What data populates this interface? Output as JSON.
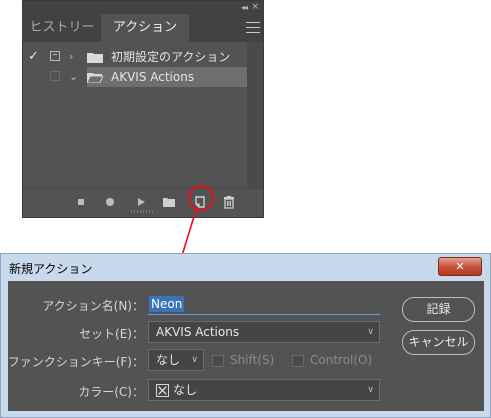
{
  "panel": {
    "tabs": [
      {
        "label": "ヒストリー",
        "active": false
      },
      {
        "label": "アクション",
        "active": true
      }
    ],
    "collapse_glyph": "◂◂",
    "close_glyph": "×",
    "rows": [
      {
        "check": "✓",
        "expanded": false,
        "label": "初期設定のアクション",
        "selected": false
      },
      {
        "check": "",
        "expanded": true,
        "label": "AKVIS Actions",
        "selected": true
      }
    ],
    "bottom_icons": [
      "stop-icon",
      "record-icon",
      "play-icon",
      "folder-icon",
      "new-action-icon",
      "trash-icon"
    ]
  },
  "annotation": {
    "color": "#e3101a"
  },
  "dialog": {
    "title": "新規アクション",
    "close_glyph": "✕",
    "name_label": "アクション名(N)：",
    "name_value": "Neon",
    "set_label": "セット(E)：",
    "set_value": "AKVIS Actions",
    "fkey_label": "ファンクションキー(F)：",
    "fkey_value": "なし",
    "shift_label": "Shift(S)",
    "control_label": "Control(O)",
    "color_label": "カラー(C)：",
    "color_value": "なし",
    "record_button": "記録",
    "cancel_button": "キャンセル"
  }
}
